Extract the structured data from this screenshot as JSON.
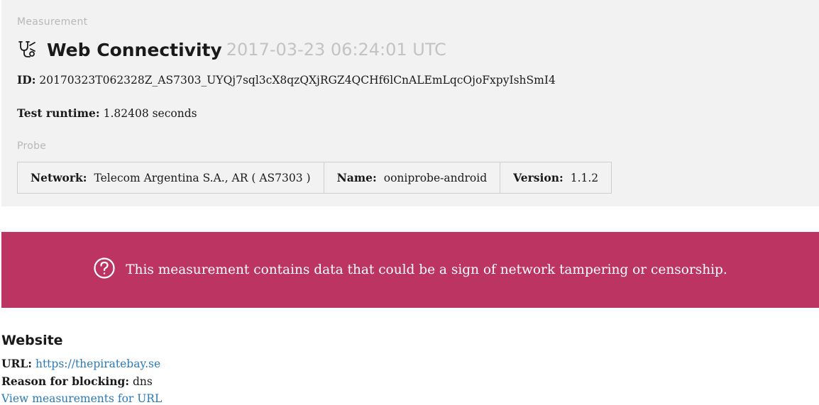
{
  "measurement": {
    "section_label": "Measurement",
    "test_name": "Web Connectivity",
    "timestamp": "2017-03-23 06:24:01 UTC",
    "id_label": "ID:",
    "id_value": "20170323T062328Z_AS7303_UYQj7sql3cX8qzQXjRGZ4QCHf6lCnALEmLqcOjoFxpyIshSmI4",
    "runtime_label": "Test runtime:",
    "runtime_value": "1.82408 seconds",
    "icon": "stethoscope-icon"
  },
  "probe": {
    "section_label": "Probe",
    "network_label": "Network:",
    "network_value": "Telecom Argentina S.A., AR ( AS7303 )",
    "name_label": "Name:",
    "name_value": "ooniprobe-android",
    "version_label": "Version:",
    "version_value": "1.1.2"
  },
  "alert": {
    "icon": "question-circle-icon",
    "message": "This measurement contains data that could be a sign of network tampering or censorship.",
    "color": "#bb3462"
  },
  "website": {
    "heading": "Website",
    "url_label": "URL:",
    "url_value": "https://thepiratebay.se",
    "reason_label": "Reason for blocking:",
    "reason_value": "dns",
    "view_link": "View measurements for URL"
  }
}
